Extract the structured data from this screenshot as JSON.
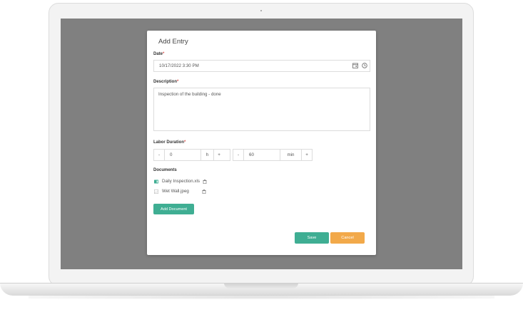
{
  "modal": {
    "title": "Add Entry",
    "date": {
      "label": "Date",
      "required_mark": "*",
      "value": "10/17/2022 3:30 PM"
    },
    "description": {
      "label": "Description",
      "required_mark": "*",
      "value": "Inspection of the building - done"
    },
    "labor": {
      "label": "Labor Duration",
      "required_mark": "*",
      "hours": {
        "minus": "-",
        "value": "0",
        "unit": "h",
        "plus": "+"
      },
      "minutes": {
        "minus": "-",
        "value": "60",
        "unit": "min",
        "plus": "+"
      }
    },
    "documents": {
      "label": "Documents",
      "items": [
        {
          "name": "Daily Inspection.xls",
          "icon": "spreadsheet-icon"
        },
        {
          "name": "Wet Wall.jpeg",
          "icon": "image-file-icon"
        }
      ],
      "add_label": "Add Document"
    },
    "buttons": {
      "save": "Save",
      "cancel": "Cancel"
    }
  },
  "colors": {
    "primary": "#3fae93",
    "warning": "#f2a94a",
    "required": "#d9534f",
    "overlay": "#808080"
  }
}
